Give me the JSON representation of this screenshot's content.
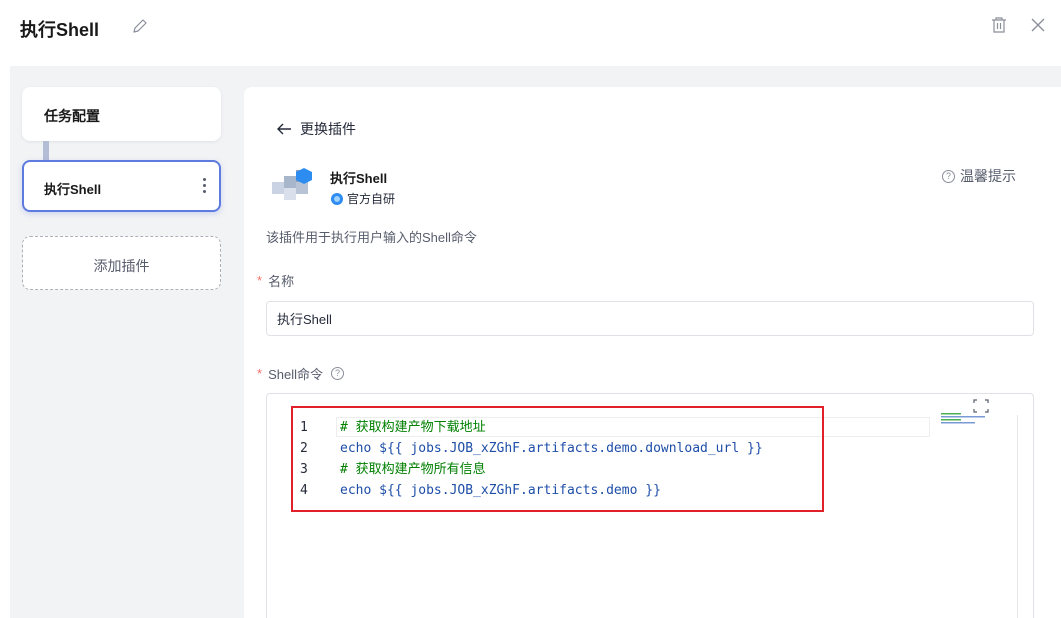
{
  "header": {
    "title": "执行Shell"
  },
  "sidebar": {
    "task_config_label": "任务配置",
    "plugin_item_label": "执行Shell",
    "add_plugin_label": "添加插件"
  },
  "panel": {
    "back_label": "更换插件",
    "plugin_name": "执行Shell",
    "badge_label": "官方自研",
    "tip_label": "温馨提示",
    "description": "该插件用于执行用户输入的Shell命令",
    "name_field": {
      "label": "名称",
      "value": "执行Shell"
    },
    "shell_field": {
      "label": "Shell命令"
    }
  },
  "editor": {
    "lines": [
      {
        "num": "1",
        "text": "# 获取构建产物下载地址",
        "comment": true
      },
      {
        "num": "2",
        "text": "echo ${{ jobs.JOB_xZGhF.artifacts.demo.download_url }}",
        "comment": false
      },
      {
        "num": "3",
        "text": "# 获取构建产物所有信息",
        "comment": true
      },
      {
        "num": "4",
        "text": "echo ${{ jobs.JOB_xZGhF.artifacts.demo }}",
        "comment": false
      }
    ]
  },
  "colors": {
    "accent": "#5e7ce0",
    "required": "#f66f6a",
    "highlight": "#e0212a",
    "comment": "#008000"
  }
}
